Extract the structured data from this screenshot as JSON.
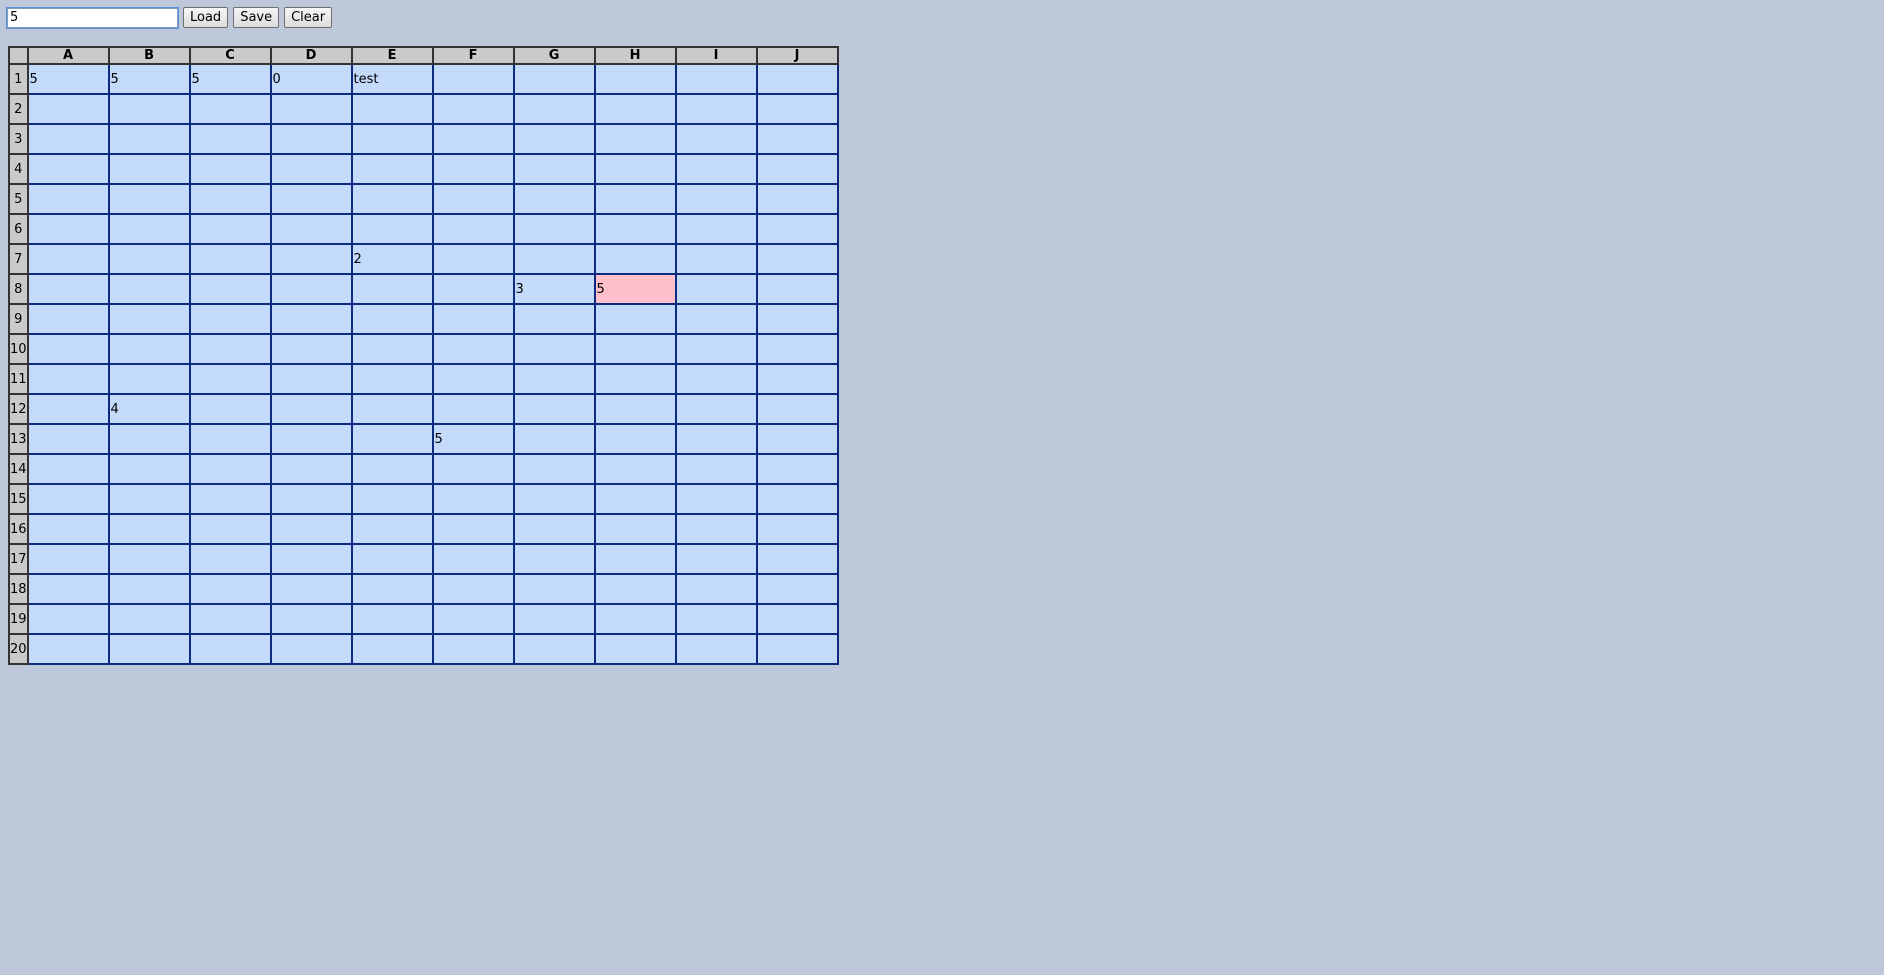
{
  "toolbar": {
    "input_value": "5",
    "load_label": "Load",
    "save_label": "Save",
    "clear_label": "Clear"
  },
  "sheet": {
    "columns": [
      "A",
      "B",
      "C",
      "D",
      "E",
      "F",
      "G",
      "H",
      "I",
      "J"
    ],
    "rows": [
      "1",
      "2",
      "3",
      "4",
      "5",
      "6",
      "7",
      "8",
      "9",
      "10",
      "11",
      "12",
      "13",
      "14",
      "15",
      "16",
      "17",
      "18",
      "19",
      "20"
    ],
    "cells": {
      "A1": "5",
      "B1": "5",
      "C1": "5",
      "D1": "0",
      "E1": "test",
      "E7": "2",
      "G8": "3",
      "H8": "5",
      "B12": "4",
      "F13": "5"
    },
    "selected_cell": "H8",
    "selected_color": "#ffc0cb",
    "cell_color": "#c4dafa",
    "header_color": "#cacaca",
    "page_background": "#bec8db"
  }
}
